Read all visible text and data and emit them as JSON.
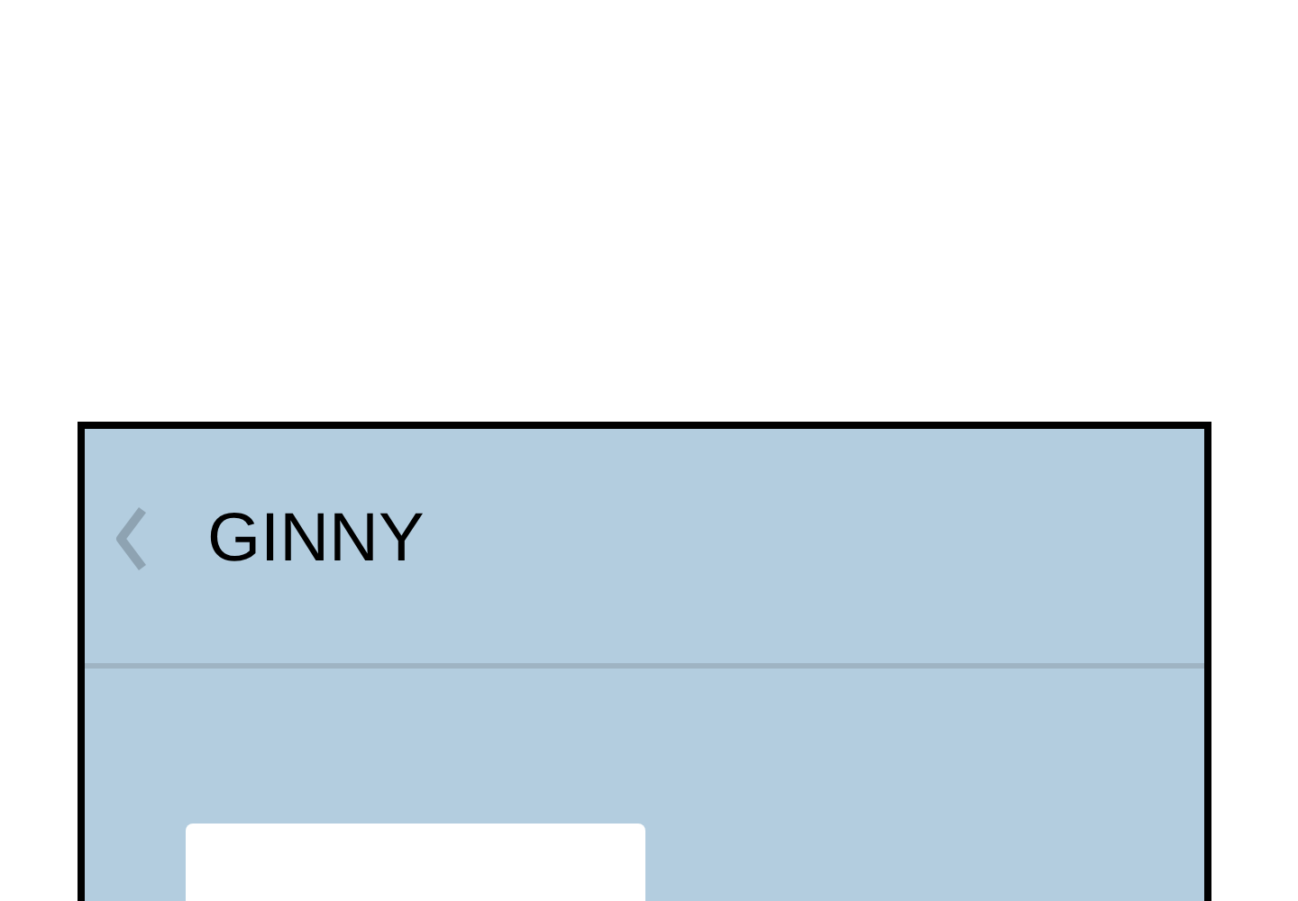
{
  "header": {
    "title": "GINNY"
  }
}
